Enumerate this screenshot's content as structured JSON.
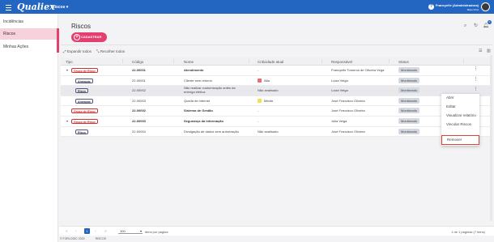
{
  "topbar": {
    "logo": "Qualiex",
    "module": "Riscos",
    "module_caret": "▾",
    "help": "?",
    "user_name": "Francyelle (Administradora)",
    "user_sub": "Base Prod"
  },
  "sidebar": {
    "items": [
      {
        "label": "Incidências"
      },
      {
        "label": "Riscos"
      },
      {
        "label": "Minhas Ações"
      }
    ]
  },
  "footer": {
    "copyright": "© FORLOGIC 2022",
    "module": "RISCOS"
  },
  "main": {
    "title": "Riscos",
    "add_button": "CADASTRAR",
    "notification_count": "0",
    "expand_all": "Expandir todos",
    "collapse_all": "Recolher todos"
  },
  "table": {
    "headers": {
      "tipo": "Tipo",
      "codigo": "Código",
      "nome": "Nome",
      "criticidade": "Criticidade atual",
      "responsavel": "Responsável",
      "status": "Status"
    },
    "rows": [
      {
        "tipo": "Grupo de Risco",
        "codigo": "22-00001",
        "nome": "Atendimento",
        "crit": "-",
        "resp": "Francyelle Tomeros de Oliveira Vega",
        "status": "Monitorado"
      },
      {
        "tipo": "Ameaças",
        "codigo": "22-00001",
        "nome": "Cliente sem retorno",
        "crit": "Alta",
        "resp": "Luiza Veiga",
        "status": "Monitorado"
      },
      {
        "tipo": "Risco",
        "codigo": "22-00002",
        "nome": "Não realizar customização antes da",
        "nome2": "entrega efetiva",
        "crit": "Não analisado",
        "resp": "Luiza Veiga",
        "status": "Monitorado"
      },
      {
        "tipo": "Ameaças",
        "codigo": "22-00003",
        "nome": "Queda de internet",
        "crit": "Média",
        "resp": "José Francisco Oliveira",
        "status": "Monitorado"
      },
      {
        "tipo": "Grupo de Risco",
        "codigo": "22-00002",
        "nome": "Sistema de Gestão",
        "crit": "-",
        "resp": "José Francisco Oliveira",
        "status": "Monitorado"
      },
      {
        "tipo": "Grupo de Risco",
        "codigo": "22-00003",
        "nome": "Segurança da Informação",
        "crit": "-",
        "resp": "Júlia Veiga",
        "status": "Monitorado"
      },
      {
        "tipo": "Risco",
        "codigo": "22-00004",
        "nome": "Divulgação de dados sem autorização",
        "crit": "Não analisado",
        "resp": "José Francisco Oliveira",
        "status": "Monitorado"
      }
    ]
  },
  "colors": {
    "brand_blue": "#2366c1",
    "accent_pink": "#e43f6f",
    "crit_alta": "#ef6b73",
    "crit_media": "#f4e04d"
  },
  "context_menu": {
    "items": [
      "Abrir",
      "Editar",
      "Visualizar relatório",
      "Vincular Riscos",
      "Remover"
    ]
  },
  "pager": {
    "current_page": "1",
    "page_size": "100",
    "page_size_label": "itens por página",
    "info": "1 de 1 páginas (7 itens)"
  }
}
